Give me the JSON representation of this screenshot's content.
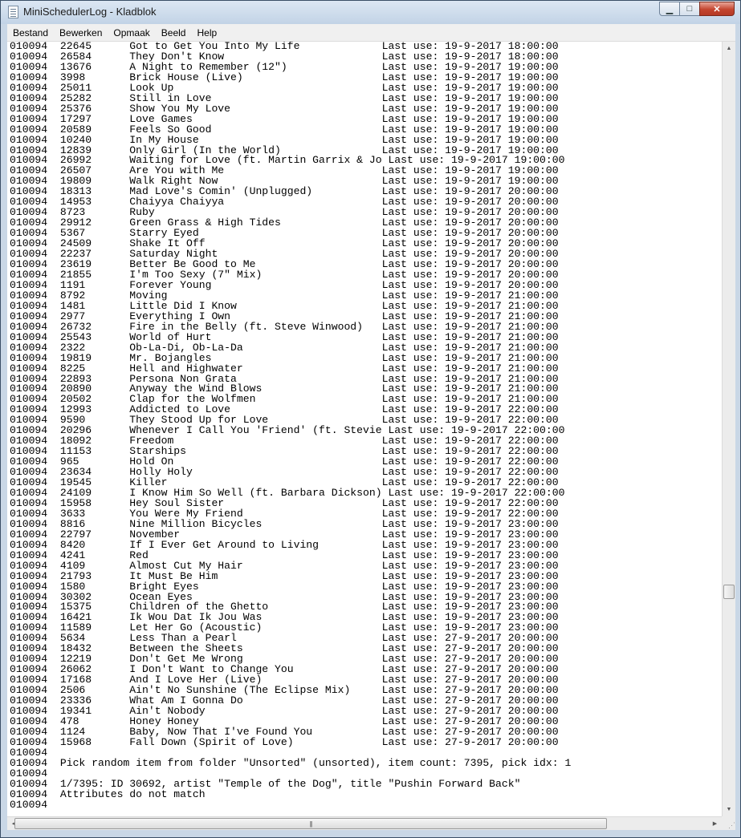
{
  "window": {
    "title": "MiniSchedulerLog - Kladblok",
    "controls": {
      "minimize": "▁",
      "maximize": "□",
      "close": "✕"
    }
  },
  "menu": [
    "Bestand",
    "Bewerken",
    "Opmaak",
    "Beeld",
    "Help"
  ],
  "content_lines": [
    "010094  22645      Got to Get You Into My Life             Last use: 19-9-2017 18:00:00",
    "010094  26584      They Don't Know                         Last use: 19-9-2017 18:00:00",
    "010094  13676      A Night to Remember (12\")               Last use: 19-9-2017 19:00:00",
    "010094  3998       Brick House (Live)                      Last use: 19-9-2017 19:00:00",
    "010094  25011      Look Up                                 Last use: 19-9-2017 19:00:00",
    "010094  25282      Still in Love                           Last use: 19-9-2017 19:00:00",
    "010094  25376      Show You My Love                        Last use: 19-9-2017 19:00:00",
    "010094  17297      Love Games                              Last use: 19-9-2017 19:00:00",
    "010094  20589      Feels So Good                           Last use: 19-9-2017 19:00:00",
    "010094  10240      In My House                             Last use: 19-9-2017 19:00:00",
    "010094  12839      Only Girl (In the World)                Last use: 19-9-2017 19:00:00",
    "010094  26992      Waiting for Love (ft. Martin Garrix & Jo Last use: 19-9-2017 19:00:00",
    "010094  26507      Are You with Me                         Last use: 19-9-2017 19:00:00",
    "010094  19809      Walk Right Now                          Last use: 19-9-2017 19:00:00",
    "010094  18313      Mad Love's Comin' (Unplugged)           Last use: 19-9-2017 20:00:00",
    "010094  14953      Chaiyya Chaiyya                         Last use: 19-9-2017 20:00:00",
    "010094  8723       Ruby                                    Last use: 19-9-2017 20:00:00",
    "010094  29912      Green Grass & High Tides                Last use: 19-9-2017 20:00:00",
    "010094  5367       Starry Eyed                             Last use: 19-9-2017 20:00:00",
    "010094  24509      Shake It Off                            Last use: 19-9-2017 20:00:00",
    "010094  22237      Saturday Night                          Last use: 19-9-2017 20:00:00",
    "010094  23619      Better Be Good to Me                    Last use: 19-9-2017 20:00:00",
    "010094  21855      I'm Too Sexy (7\" Mix)                   Last use: 19-9-2017 20:00:00",
    "010094  1191       Forever Young                           Last use: 19-9-2017 20:00:00",
    "010094  8792       Moving                                  Last use: 19-9-2017 21:00:00",
    "010094  1481       Little Did I Know                       Last use: 19-9-2017 21:00:00",
    "010094  2977       Everything I Own                        Last use: 19-9-2017 21:00:00",
    "010094  26732      Fire in the Belly (ft. Steve Winwood)   Last use: 19-9-2017 21:00:00",
    "010094  25543      World of Hurt                           Last use: 19-9-2017 21:00:00",
    "010094  2322       Ob-La-Di, Ob-La-Da                      Last use: 19-9-2017 21:00:00",
    "010094  19819      Mr. Bojangles                           Last use: 19-9-2017 21:00:00",
    "010094  8225       Hell and Highwater                      Last use: 19-9-2017 21:00:00",
    "010094  22893      Persona Non Grata                       Last use: 19-9-2017 21:00:00",
    "010094  20890      Anyway the Wind Blows                   Last use: 19-9-2017 21:00:00",
    "010094  20502      Clap for the Wolfmen                    Last use: 19-9-2017 21:00:00",
    "010094  12993      Addicted to Love                        Last use: 19-9-2017 22:00:00",
    "010094  9590       They Stood Up for Love                  Last use: 19-9-2017 22:00:00",
    "010094  20296      Whenever I Call You 'Friend' (ft. Stevie Last use: 19-9-2017 22:00:00",
    "010094  18092      Freedom                                 Last use: 19-9-2017 22:00:00",
    "010094  11153      Starships                               Last use: 19-9-2017 22:00:00",
    "010094  965        Hold On                                 Last use: 19-9-2017 22:00:00",
    "010094  23634      Holly Holy                              Last use: 19-9-2017 22:00:00",
    "010094  19545      Killer                                  Last use: 19-9-2017 22:00:00",
    "010094  24109      I Know Him So Well (ft. Barbara Dickson) Last use: 19-9-2017 22:00:00",
    "010094  15958      Hey Soul Sister                         Last use: 19-9-2017 22:00:00",
    "010094  3633       You Were My Friend                      Last use: 19-9-2017 22:00:00",
    "010094  8816       Nine Million Bicycles                   Last use: 19-9-2017 23:00:00",
    "010094  22797      November                                Last use: 19-9-2017 23:00:00",
    "010094  8420       If I Ever Get Around to Living          Last use: 19-9-2017 23:00:00",
    "010094  4241       Red                                     Last use: 19-9-2017 23:00:00",
    "010094  4109       Almost Cut My Hair                      Last use: 19-9-2017 23:00:00",
    "010094  21793      It Must Be Him                          Last use: 19-9-2017 23:00:00",
    "010094  1580       Bright Eyes                             Last use: 19-9-2017 23:00:00",
    "010094  30302      Ocean Eyes                              Last use: 19-9-2017 23:00:00",
    "010094  15375      Children of the Ghetto                  Last use: 19-9-2017 23:00:00",
    "010094  16421      Ik Wou Dat Ik Jou Was                   Last use: 19-9-2017 23:00:00",
    "010094  11589      Let Her Go (Acoustic)                   Last use: 19-9-2017 23:00:00",
    "010094  5634       Less Than a Pearl                       Last use: 27-9-2017 20:00:00",
    "010094  18432      Between the Sheets                      Last use: 27-9-2017 20:00:00",
    "010094  12219      Don't Get Me Wrong                      Last use: 27-9-2017 20:00:00",
    "010094  26062      I Don't Want to Change You              Last use: 27-9-2017 20:00:00",
    "010094  17168      And I Love Her (Live)                   Last use: 27-9-2017 20:00:00",
    "010094  2506       Ain't No Sunshine (The Eclipse Mix)     Last use: 27-9-2017 20:00:00",
    "010094  23336      What Am I Gonna Do                      Last use: 27-9-2017 20:00:00",
    "010094  19341      Ain't Nobody                            Last use: 27-9-2017 20:00:00",
    "010094  478        Honey Honey                             Last use: 27-9-2017 20:00:00",
    "010094  1124       Baby, Now That I've Found You           Last use: 27-9-2017 20:00:00",
    "010094  15968      Fall Down (Spirit of Love)              Last use: 27-9-2017 20:00:00",
    "010094",
    "010094  Pick random item from folder \"Unsorted\" (unsorted), item count: 7395, pick idx: 1",
    "010094",
    "010094  1/7395: ID 30692, artist \"Temple of the Dog\", title \"Pushin Forward Back\"",
    "010094  Attributes do not match",
    "010094"
  ]
}
